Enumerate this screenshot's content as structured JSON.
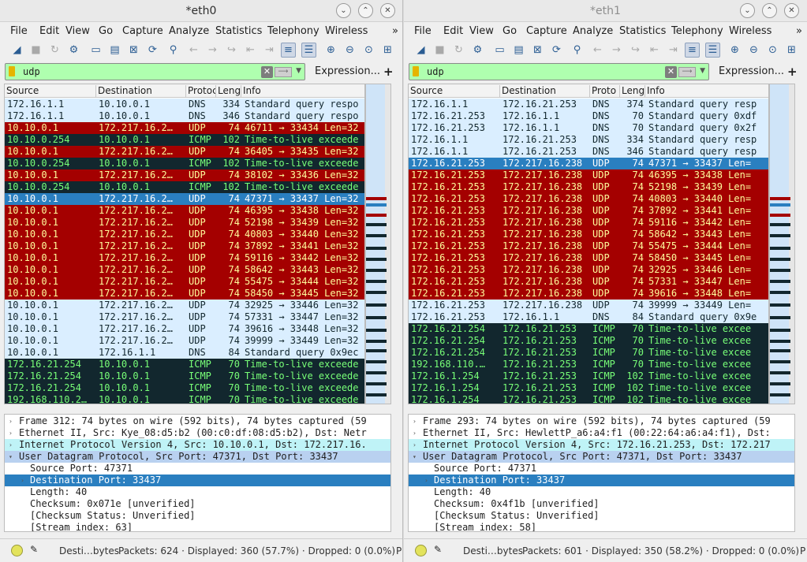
{
  "left": {
    "title": "*eth0",
    "menu": [
      "File",
      "Edit",
      "View",
      "Go",
      "Capture",
      "Analyze",
      "Statistics",
      "Telephony",
      "Wireless",
      "»"
    ],
    "filter": {
      "value": "udp",
      "expression_label": "Expression...",
      "plus": "+"
    },
    "columns": [
      "Source",
      "Destination",
      "Protoc",
      "Leng",
      "Info"
    ],
    "rows": [
      {
        "c": "norm",
        "src": "172.16.1.1",
        "dst": "10.10.0.1",
        "proto": "DNS",
        "len": "334",
        "info": "Standard query respo"
      },
      {
        "c": "norm",
        "src": "172.16.1.1",
        "dst": "10.10.0.1",
        "proto": "DNS",
        "len": "346",
        "info": "Standard query respo"
      },
      {
        "c": "red",
        "src": "10.10.0.1",
        "dst": "172.217.16.2…",
        "proto": "UDP",
        "len": "74",
        "info": "46711 → 33434 Len=32"
      },
      {
        "c": "icmp",
        "src": "10.10.0.254",
        "dst": "10.10.0.1",
        "proto": "ICMP",
        "len": "102",
        "info": "Time-to-live exceede"
      },
      {
        "c": "red",
        "src": "10.10.0.1",
        "dst": "172.217.16.2…",
        "proto": "UDP",
        "len": "74",
        "info": "36405 → 33435 Len=32"
      },
      {
        "c": "icmp",
        "src": "10.10.0.254",
        "dst": "10.10.0.1",
        "proto": "ICMP",
        "len": "102",
        "info": "Time-to-live exceede"
      },
      {
        "c": "red",
        "src": "10.10.0.1",
        "dst": "172.217.16.2…",
        "proto": "UDP",
        "len": "74",
        "info": "38102 → 33436 Len=32"
      },
      {
        "c": "icmp",
        "src": "10.10.0.254",
        "dst": "10.10.0.1",
        "proto": "ICMP",
        "len": "102",
        "info": "Time-to-live exceede"
      },
      {
        "c": "sel",
        "src": "10.10.0.1",
        "dst": "172.217.16.2…",
        "proto": "UDP",
        "len": "74",
        "info": "47371 → 33437 Len=32"
      },
      {
        "c": "red",
        "src": "10.10.0.1",
        "dst": "172.217.16.2…",
        "proto": "UDP",
        "len": "74",
        "info": "46395 → 33438 Len=32"
      },
      {
        "c": "red",
        "src": "10.10.0.1",
        "dst": "172.217.16.2…",
        "proto": "UDP",
        "len": "74",
        "info": "52198 → 33439 Len=32"
      },
      {
        "c": "red",
        "src": "10.10.0.1",
        "dst": "172.217.16.2…",
        "proto": "UDP",
        "len": "74",
        "info": "40803 → 33440 Len=32"
      },
      {
        "c": "red",
        "src": "10.10.0.1",
        "dst": "172.217.16.2…",
        "proto": "UDP",
        "len": "74",
        "info": "37892 → 33441 Len=32"
      },
      {
        "c": "red",
        "src": "10.10.0.1",
        "dst": "172.217.16.2…",
        "proto": "UDP",
        "len": "74",
        "info": "59116 → 33442 Len=32"
      },
      {
        "c": "red",
        "src": "10.10.0.1",
        "dst": "172.217.16.2…",
        "proto": "UDP",
        "len": "74",
        "info": "58642 → 33443 Len=32"
      },
      {
        "c": "red",
        "src": "10.10.0.1",
        "dst": "172.217.16.2…",
        "proto": "UDP",
        "len": "74",
        "info": "55475 → 33444 Len=32"
      },
      {
        "c": "red",
        "src": "10.10.0.1",
        "dst": "172.217.16.2…",
        "proto": "UDP",
        "len": "74",
        "info": "58450 → 33445 Len=32"
      },
      {
        "c": "norm",
        "src": "10.10.0.1",
        "dst": "172.217.16.2…",
        "proto": "UDP",
        "len": "74",
        "info": "32925 → 33446 Len=32"
      },
      {
        "c": "norm",
        "src": "10.10.0.1",
        "dst": "172.217.16.2…",
        "proto": "UDP",
        "len": "74",
        "info": "57331 → 33447 Len=32"
      },
      {
        "c": "norm",
        "src": "10.10.0.1",
        "dst": "172.217.16.2…",
        "proto": "UDP",
        "len": "74",
        "info": "39616 → 33448 Len=32"
      },
      {
        "c": "norm",
        "src": "10.10.0.1",
        "dst": "172.217.16.2…",
        "proto": "UDP",
        "len": "74",
        "info": "39999 → 33449 Len=32"
      },
      {
        "c": "norm",
        "src": "10.10.0.1",
        "dst": "172.16.1.1",
        "proto": "DNS",
        "len": "84",
        "info": "Standard query 0x9ec"
      },
      {
        "c": "icmp",
        "src": "172.16.21.254",
        "dst": "10.10.0.1",
        "proto": "ICMP",
        "len": "70",
        "info": "Time-to-live exceede"
      },
      {
        "c": "icmp",
        "src": "172.16.21.254",
        "dst": "10.10.0.1",
        "proto": "ICMP",
        "len": "70",
        "info": "Time-to-live exceede"
      },
      {
        "c": "icmp",
        "src": "172.16.21.254",
        "dst": "10.10.0.1",
        "proto": "ICMP",
        "len": "70",
        "info": "Time-to-live exceede"
      },
      {
        "c": "icmp",
        "src": "192.168.110.2…",
        "dst": "10.10.0.1",
        "proto": "ICMP",
        "len": "70",
        "info": "Time-to-live exceede"
      }
    ],
    "details": [
      {
        "t": "plain",
        "text": "Frame 312: 74 bytes on wire (592 bits), 74 bytes captured (59"
      },
      {
        "t": "plain",
        "text": "Ethernet II, Src: Kye_08:d5:b2 (00:c0:df:08:d5:b2), Dst: Netr"
      },
      {
        "t": "ip",
        "text": "Internet Protocol Version 4, Src: 10.10.0.1, Dst: 172.217.16."
      },
      {
        "t": "udp",
        "text": "User Datagram Protocol, Src Port: 47371, Dst Port: 33437"
      },
      {
        "t": "sub",
        "text": "Source Port: 47371"
      },
      {
        "t": "subsel",
        "text": "Destination Port: 33437"
      },
      {
        "t": "sub",
        "text": "Length: 40"
      },
      {
        "t": "sub",
        "text": "Checksum: 0x071e [unverified]"
      },
      {
        "t": "sub",
        "text": "[Checksum Status: Unverified]"
      },
      {
        "t": "sub",
        "text": "[Stream index: 63]"
      }
    ],
    "status": {
      "field": "Desti…bytes",
      "packets": "Packets: 624 · Displayed: 360 (57.7%) · Dropped: 0 (0.0%)",
      "profile": "P"
    }
  },
  "right": {
    "title": "*eth1",
    "menu": [
      "File",
      "Edit",
      "View",
      "Go",
      "Capture",
      "Analyze",
      "Statistics",
      "Telephony",
      "Wireless",
      "»"
    ],
    "filter": {
      "value": "udp",
      "expression_label": "Expression...",
      "plus": "+"
    },
    "columns": [
      "Source",
      "Destination",
      "Proto",
      "Lengt",
      "Info"
    ],
    "rows": [
      {
        "c": "norm",
        "src": "172.16.1.1",
        "dst": "172.16.21.253",
        "proto": "DNS",
        "len": "374",
        "info": "Standard query resp"
      },
      {
        "c": "norm",
        "src": "172.16.21.253",
        "dst": "172.16.1.1",
        "proto": "DNS",
        "len": "70",
        "info": "Standard query 0xdf"
      },
      {
        "c": "norm",
        "src": "172.16.21.253",
        "dst": "172.16.1.1",
        "proto": "DNS",
        "len": "70",
        "info": "Standard query 0x2f"
      },
      {
        "c": "norm",
        "src": "172.16.1.1",
        "dst": "172.16.21.253",
        "proto": "DNS",
        "len": "334",
        "info": "Standard query resp"
      },
      {
        "c": "norm",
        "src": "172.16.1.1",
        "dst": "172.16.21.253",
        "proto": "DNS",
        "len": "346",
        "info": "Standard query resp"
      },
      {
        "c": "sel",
        "src": "172.16.21.253",
        "dst": "172.217.16.238",
        "proto": "UDP",
        "len": "74",
        "info": "47371 → 33437 Len="
      },
      {
        "c": "red",
        "src": "172.16.21.253",
        "dst": "172.217.16.238",
        "proto": "UDP",
        "len": "74",
        "info": "46395 → 33438 Len="
      },
      {
        "c": "red",
        "src": "172.16.21.253",
        "dst": "172.217.16.238",
        "proto": "UDP",
        "len": "74",
        "info": "52198 → 33439 Len="
      },
      {
        "c": "red",
        "src": "172.16.21.253",
        "dst": "172.217.16.238",
        "proto": "UDP",
        "len": "74",
        "info": "40803 → 33440 Len="
      },
      {
        "c": "red",
        "src": "172.16.21.253",
        "dst": "172.217.16.238",
        "proto": "UDP",
        "len": "74",
        "info": "37892 → 33441 Len="
      },
      {
        "c": "red",
        "src": "172.16.21.253",
        "dst": "172.217.16.238",
        "proto": "UDP",
        "len": "74",
        "info": "59116 → 33442 Len="
      },
      {
        "c": "red",
        "src": "172.16.21.253",
        "dst": "172.217.16.238",
        "proto": "UDP",
        "len": "74",
        "info": "58642 → 33443 Len="
      },
      {
        "c": "red",
        "src": "172.16.21.253",
        "dst": "172.217.16.238",
        "proto": "UDP",
        "len": "74",
        "info": "55475 → 33444 Len="
      },
      {
        "c": "red",
        "src": "172.16.21.253",
        "dst": "172.217.16.238",
        "proto": "UDP",
        "len": "74",
        "info": "58450 → 33445 Len="
      },
      {
        "c": "red",
        "src": "172.16.21.253",
        "dst": "172.217.16.238",
        "proto": "UDP",
        "len": "74",
        "info": "32925 → 33446 Len="
      },
      {
        "c": "red",
        "src": "172.16.21.253",
        "dst": "172.217.16.238",
        "proto": "UDP",
        "len": "74",
        "info": "57331 → 33447 Len="
      },
      {
        "c": "red",
        "src": "172.16.21.253",
        "dst": "172.217.16.238",
        "proto": "UDP",
        "len": "74",
        "info": "39616 → 33448 Len="
      },
      {
        "c": "norm",
        "src": "172.16.21.253",
        "dst": "172.217.16.238",
        "proto": "UDP",
        "len": "74",
        "info": "39999 → 33449 Len="
      },
      {
        "c": "norm",
        "src": "172.16.21.253",
        "dst": "172.16.1.1",
        "proto": "DNS",
        "len": "84",
        "info": "Standard query 0x9e"
      },
      {
        "c": "icmp",
        "src": "172.16.21.254",
        "dst": "172.16.21.253",
        "proto": "ICMP",
        "len": "70",
        "info": "Time-to-live excee"
      },
      {
        "c": "icmp",
        "src": "172.16.21.254",
        "dst": "172.16.21.253",
        "proto": "ICMP",
        "len": "70",
        "info": "Time-to-live excee"
      },
      {
        "c": "icmp",
        "src": "172.16.21.254",
        "dst": "172.16.21.253",
        "proto": "ICMP",
        "len": "70",
        "info": "Time-to-live excee"
      },
      {
        "c": "icmp",
        "src": "192.168.110.…",
        "dst": "172.16.21.253",
        "proto": "ICMP",
        "len": "70",
        "info": "Time-to-live excee"
      },
      {
        "c": "icmp",
        "src": "172.16.1.254",
        "dst": "172.16.21.253",
        "proto": "ICMP",
        "len": "102",
        "info": "Time-to-live excee"
      },
      {
        "c": "icmp",
        "src": "172.16.1.254",
        "dst": "172.16.21.253",
        "proto": "ICMP",
        "len": "102",
        "info": "Time-to-live excee"
      },
      {
        "c": "icmp",
        "src": "172.16.1.254",
        "dst": "172.16.21.253",
        "proto": "ICMP",
        "len": "102",
        "info": "Time-to-live excee"
      }
    ],
    "details": [
      {
        "t": "plain",
        "text": "Frame 293: 74 bytes on wire (592 bits), 74 bytes captured (59"
      },
      {
        "t": "plain",
        "text": "Ethernet II, Src: HewlettP_a6:a4:f1 (00:22:64:a6:a4:f1), Dst:"
      },
      {
        "t": "ip",
        "text": "Internet Protocol Version 4, Src: 172.16.21.253, Dst: 172.217"
      },
      {
        "t": "udp",
        "text": "User Datagram Protocol, Src Port: 47371, Dst Port: 33437"
      },
      {
        "t": "sub",
        "text": "Source Port: 47371"
      },
      {
        "t": "subsel",
        "text": "Destination Port: 33437"
      },
      {
        "t": "sub",
        "text": "Length: 40"
      },
      {
        "t": "sub",
        "text": "Checksum: 0x4f1b [unverified]"
      },
      {
        "t": "sub",
        "text": "[Checksum Status: Unverified]"
      },
      {
        "t": "sub",
        "text": "[Stream index: 58]"
      }
    ],
    "status": {
      "field": "Desti…bytes",
      "packets": "Packets: 601 · Displayed: 350 (58.2%) · Dropped: 0 (0.0%)",
      "profile": "P"
    }
  },
  "toolbar_icons": [
    "shark-fin-start-icon",
    "stop-icon",
    "restart-icon",
    "options-gear-icon",
    "open-folder-icon",
    "save-file-icon",
    "close-file-icon",
    "reload-icon",
    "find-icon",
    "go-back-icon",
    "go-forward-icon",
    "go-to-packet-icon",
    "first-packet-icon",
    "last-packet-icon",
    "autoscroll-icon",
    "colorize-icon",
    "zoom-in-icon",
    "zoom-out-icon",
    "normal-size-icon",
    "resize-columns-icon"
  ],
  "colors": {
    "udp_row": "#a40000",
    "udp_row_text": "#fffc9c",
    "icmp_row": "#12272e",
    "icmp_row_text": "#78ff78",
    "selected": "#2a7fc0",
    "normal_row": "#daeeff",
    "filter_ok": "#afffaf"
  }
}
